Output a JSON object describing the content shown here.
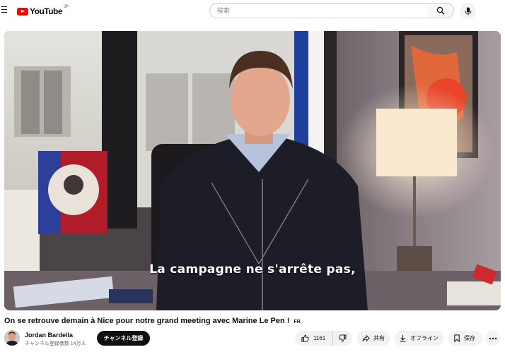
{
  "header": {
    "logo_text": "YouTube",
    "logo_sup": "JP",
    "search_placeholder": "検索"
  },
  "video": {
    "caption": "La campagne ne s'arrête pas,"
  },
  "title": "On se retrouve demain à Nice pour notre grand meeting avec Marine Le Pen !",
  "title_lang": "FR",
  "channel": {
    "name": "Jordan Bardella",
    "subscribers": "チャンネル登録者数 14万人",
    "subscribe_label": "チャンネル登録"
  },
  "actions": {
    "like_count": "1161",
    "share_label": "共有",
    "offline_label": "オフライン",
    "save_label": "保存"
  },
  "colors": {
    "brand_red": "#ff0000",
    "text_primary": "#0f0f0f",
    "text_secondary": "#606060",
    "pill_bg": "#f2f2f2"
  },
  "icons": [
    "menu-icon",
    "youtube-logo-icon",
    "search-icon",
    "mic-icon",
    "like-icon",
    "dislike-icon",
    "share-icon",
    "download-icon",
    "save-icon",
    "more-icon"
  ]
}
